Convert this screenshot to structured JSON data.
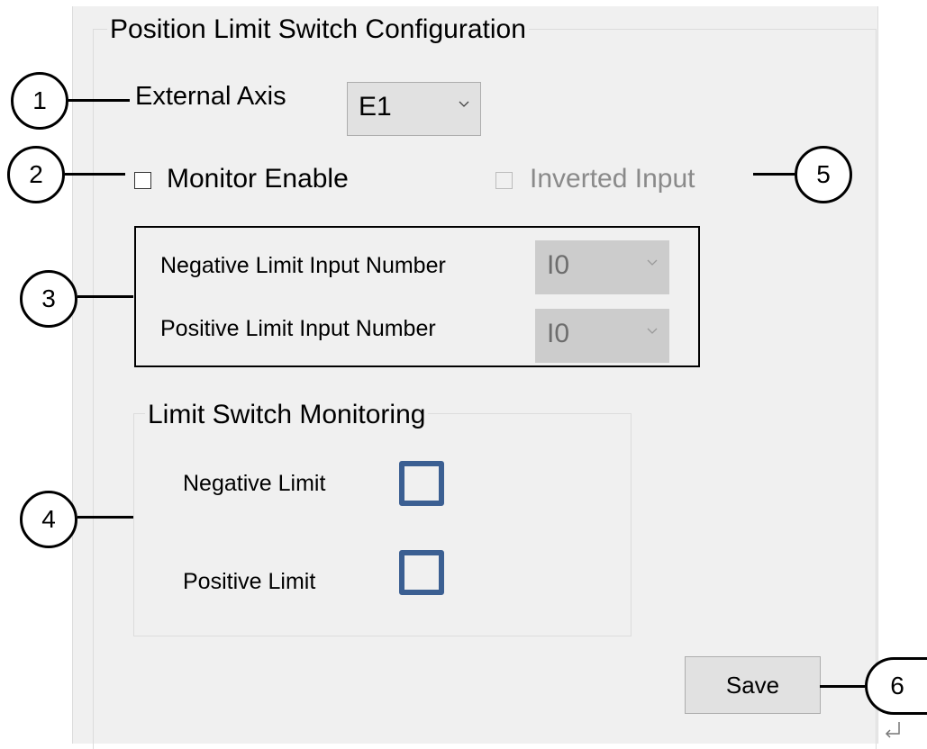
{
  "dialog": {
    "title": "Position Limit Switch Configuration",
    "external_axis": {
      "label": "External Axis",
      "value": "E1"
    },
    "monitor_enable": {
      "label": "Monitor Enable",
      "checked": false
    },
    "inverted_input": {
      "label": "Inverted Input",
      "checked": false,
      "enabled": false
    },
    "negative_limit_input": {
      "label": "Negative Limit Input Number",
      "value": "I0"
    },
    "positive_limit_input": {
      "label": "Positive Limit Input Number",
      "value": "I0"
    },
    "monitoring": {
      "title": "Limit Switch Monitoring",
      "negative_label": "Negative Limit",
      "positive_label": "Positive Limit"
    },
    "save_label": "Save"
  },
  "callouts": [
    "1",
    "2",
    "3",
    "4",
    "5",
    "6"
  ],
  "colors": {
    "panel_bg": "#f0f0f0",
    "led_border": "#3b5f92"
  },
  "icons": {
    "dropdown": "chevron-down-icon",
    "return": "return-arrow-icon"
  }
}
